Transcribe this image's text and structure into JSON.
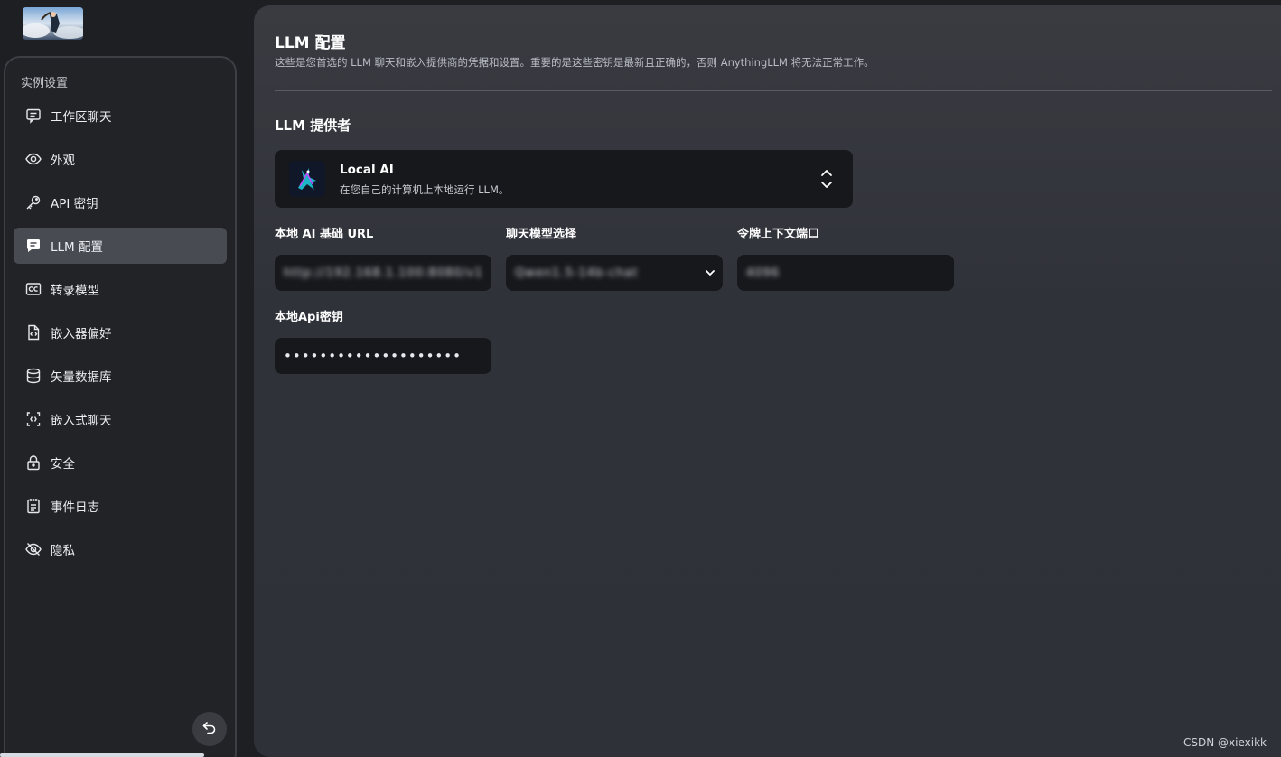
{
  "sidebar": {
    "title": "实例设置",
    "items": [
      {
        "label": "工作区聊天",
        "icon": "chat-text-icon",
        "active": false
      },
      {
        "label": "外观",
        "icon": "eye-icon",
        "active": false
      },
      {
        "label": "API 密钥",
        "icon": "key-icon",
        "active": false
      },
      {
        "label": "LLM 配置",
        "icon": "chat-bubble-icon",
        "active": true
      },
      {
        "label": "转录模型",
        "icon": "cc-icon",
        "active": false
      },
      {
        "label": "嵌入器偏好",
        "icon": "file-code-icon",
        "active": false
      },
      {
        "label": "矢量数据库",
        "icon": "database-icon",
        "active": false
      },
      {
        "label": "嵌入式聊天",
        "icon": "bracket-code-icon",
        "active": false
      },
      {
        "label": "安全",
        "icon": "lock-icon",
        "active": false
      },
      {
        "label": "事件日志",
        "icon": "notepad-icon",
        "active": false
      },
      {
        "label": "隐私",
        "icon": "eye-slash-icon",
        "active": false
      }
    ]
  },
  "main": {
    "title": "LLM 配置",
    "description": "这些是您首选的 LLM 聊天和嵌入提供商的凭据和设置。重要的是这些密钥是最新且正确的，否则 AnythingLLM 将无法正常工作。",
    "section_title": "LLM 提供者",
    "provider": {
      "name": "Local AI",
      "description": "在您自己的计算机上本地运行 LLM。"
    },
    "fields": {
      "base_url": {
        "label": "本地 AI 基础 URL",
        "value": "http://192.168.1.100:8080/v1"
      },
      "chat_model": {
        "label": "聊天模型选择",
        "value": "Qwen1.5-14b-chat"
      },
      "token_window": {
        "label": "令牌上下文端口",
        "value": "4096"
      },
      "api_key": {
        "label": "本地Api密钥",
        "value": "••••••••••••••••••••"
      }
    }
  },
  "watermark": "CSDN @xiexikk",
  "colors": {
    "background": "#1e1f23",
    "sidebar": "#222327",
    "active_item": "#484b52",
    "input": "#17181c",
    "main_panel": "#34363d"
  }
}
